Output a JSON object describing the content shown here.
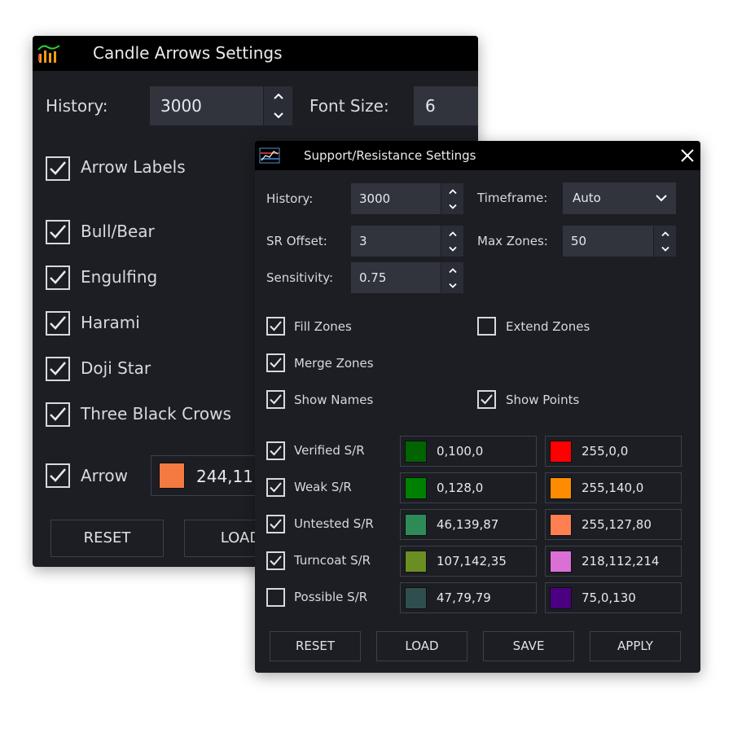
{
  "candle_window": {
    "title": "Candle Arrows Settings",
    "icon": "bar-chart-icon",
    "history_label": "History:",
    "history_value": "3000",
    "font_size_label": "Font Size:",
    "font_size_value": "6",
    "checkboxes": [
      {
        "label": "Arrow Labels",
        "checked": true
      },
      {
        "label": "Bull/Bear",
        "checked": true
      },
      {
        "label": "Engulfing",
        "checked": true
      },
      {
        "label": "Harami",
        "checked": true
      },
      {
        "label": "Doji Star",
        "checked": true
      },
      {
        "label": "Three Black Crows",
        "checked": true
      }
    ],
    "arrow": {
      "label": "Arrow",
      "checked": true,
      "color": "#f47a41",
      "value": "244,11"
    },
    "buttons": {
      "reset": "RESET",
      "load": "LOAD"
    }
  },
  "sr_window": {
    "title": "Support/Resistance Settings",
    "icon": "chart-line-icon",
    "close_icon": "close-icon",
    "fields": {
      "history": {
        "label": "History:",
        "value": "3000"
      },
      "timeframe": {
        "label": "Timeframe:",
        "value": "Auto"
      },
      "sr_offset": {
        "label": "SR Offset:",
        "value": "3"
      },
      "max_zones": {
        "label": "Max Zones:",
        "value": "50"
      },
      "sensitivity": {
        "label": "Sensitivity:",
        "value": "0.75"
      }
    },
    "options": [
      {
        "label": "Fill Zones",
        "checked": true
      },
      {
        "label": "Extend Zones",
        "checked": false
      },
      {
        "label": "Merge Zones",
        "checked": true
      },
      {
        "label": "Show Names",
        "checked": true
      },
      {
        "label": "Show Points",
        "checked": true
      }
    ],
    "zones": [
      {
        "label": "Verified S/R",
        "checked": true,
        "support": {
          "color": "#006400",
          "value": "0,100,0"
        },
        "resistance": {
          "color": "#ff0000",
          "value": "255,0,0"
        }
      },
      {
        "label": "Weak S/R",
        "checked": true,
        "support": {
          "color": "#008000",
          "value": "0,128,0"
        },
        "resistance": {
          "color": "#ff8c00",
          "value": "255,140,0"
        }
      },
      {
        "label": "Untested S/R",
        "checked": true,
        "support": {
          "color": "#2e8b57",
          "value": "46,139,87"
        },
        "resistance": {
          "color": "#ff7f50",
          "value": "255,127,80"
        }
      },
      {
        "label": "Turncoat S/R",
        "checked": true,
        "support": {
          "color": "#6b8e23",
          "value": "107,142,35"
        },
        "resistance": {
          "color": "#da70d6",
          "value": "218,112,214"
        }
      },
      {
        "label": "Possible S/R",
        "checked": false,
        "support": {
          "color": "#2f4f4f",
          "value": "47,79,79"
        },
        "resistance": {
          "color": "#4b0082",
          "value": "75,0,130"
        }
      }
    ],
    "buttons": {
      "reset": "RESET",
      "load": "LOAD",
      "save": "SAVE",
      "apply": "APPLY"
    }
  }
}
